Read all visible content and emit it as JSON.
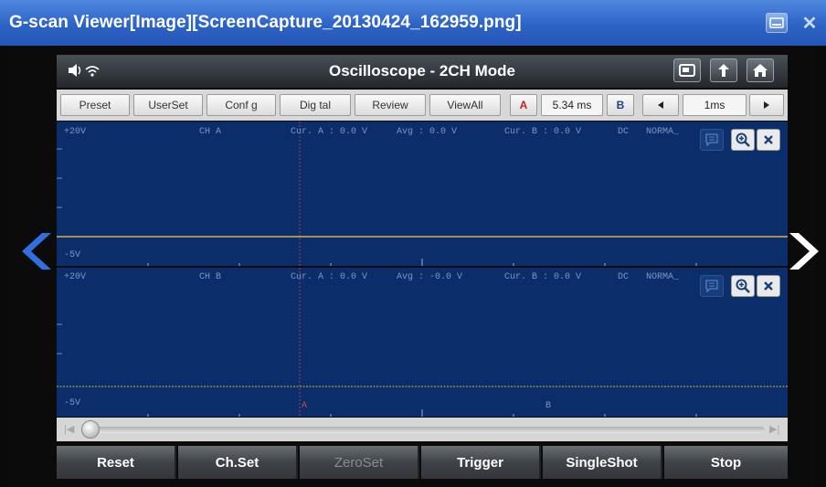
{
  "window": {
    "title": "G-scan Viewer[Image][ScreenCapture_20130424_162959.png]",
    "minimize_icon": "window-minimize-icon",
    "close_glyph": "✕"
  },
  "app": {
    "title": "Oscilloscope - 2CH Mode",
    "header_icons": [
      "screen-capture-icon",
      "back-icon",
      "home-icon"
    ]
  },
  "toolbar": {
    "preset": "Preset",
    "userset": "UserSet",
    "config": "Conf g",
    "digital": "Dig tal",
    "review": "Review",
    "viewall": "ViewAll",
    "marker_a": "A",
    "time_value": "5.34 ms",
    "marker_b": "B",
    "timebase": "1ms"
  },
  "channels": [
    {
      "top_label": "+20V",
      "bottom_label": "-5V",
      "name": "CH A",
      "cur_a": "Cur. A : 0.0 V",
      "avg": "Avg : 0.0 V",
      "cur_b": "Cur. B : 0.0 V",
      "coupling": "DC",
      "mode": "NORMA_"
    },
    {
      "top_label": "+20V",
      "bottom_label": "-5V",
      "name": "CH B",
      "cur_a": "Cur. A : 0.0 V",
      "avg": "Avg : -0.0 V",
      "cur_b": "Cur. B : 0.0 V",
      "coupling": "DC",
      "mode": "NORMA_",
      "marker_a": "A",
      "marker_b": "B"
    }
  ],
  "colors": {
    "panel_bg": "#0b2e6b",
    "signal": "#d8b24a",
    "cursor": "#c84a4a",
    "accent": "#2d63c6"
  },
  "bottom": {
    "reset": "Reset",
    "chset": "Ch.Set",
    "zeroset": "ZeroSet",
    "trigger": "Trigger",
    "singleshot": "SingleShot",
    "stop": "Stop"
  },
  "scroll_position": 0.0
}
